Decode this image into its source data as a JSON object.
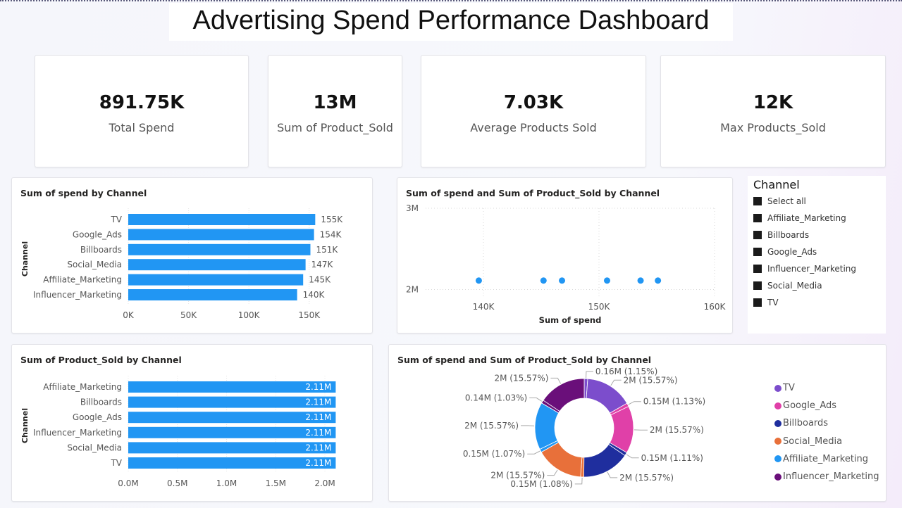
{
  "title": "Advertising Spend Performance Dashboard",
  "kpis": [
    {
      "value": "891.75K",
      "label": "Total Spend"
    },
    {
      "value": "13M",
      "label": "Sum of Product_Sold"
    },
    {
      "value": "7.03K",
      "label": "Average Products Sold"
    },
    {
      "value": "12K",
      "label": "Max Products_Sold"
    }
  ],
  "slicer": {
    "title": "Channel",
    "items": [
      "Select all",
      "Affiliate_Marketing",
      "Billboards",
      "Google_Ads",
      "Influencer_Marketing",
      "Social_Media",
      "TV"
    ]
  },
  "colors": {
    "bar": "#2196f3",
    "TV": "#7c4dcc",
    "Google_Ads": "#e040a8",
    "Billboards": "#1f2e9e",
    "Social_Media": "#e8703a",
    "Affiliate_Marketing": "#2196f3",
    "Influencer_Marketing": "#6a0f7a"
  },
  "chart_data": [
    {
      "type": "bar",
      "orientation": "horizontal",
      "title": "Sum of spend by Channel",
      "ylabel": "Channel",
      "categories": [
        "TV",
        "Google_Ads",
        "Billboards",
        "Social_Media",
        "Affiliate_Marketing",
        "Influencer_Marketing"
      ],
      "values": [
        155000,
        154000,
        151000,
        147000,
        145000,
        140000
      ],
      "data_labels": [
        "155K",
        "154K",
        "151K",
        "147K",
        "145K",
        "140K"
      ],
      "xlim": [
        0,
        170000
      ],
      "xticks": [
        0,
        50000,
        100000,
        150000
      ],
      "xtick_labels": [
        "0K",
        "50K",
        "100K",
        "150K"
      ]
    },
    {
      "type": "scatter",
      "title": "Sum of spend and Sum of Product_Sold by Channel",
      "xlabel": "Sum of spend",
      "x": [
        139600,
        145200,
        146800,
        150700,
        153600,
        155100
      ],
      "y": [
        2110000,
        2110000,
        2110000,
        2110000,
        2110000,
        2110000
      ],
      "xlim": [
        140000,
        160000
      ],
      "ylim": [
        1900000,
        3000000
      ],
      "xticks": [
        140000,
        150000,
        160000
      ],
      "xtick_labels": [
        "140K",
        "150K",
        "160K"
      ],
      "yticks": [
        2000000,
        3000000
      ],
      "ytick_labels": [
        "2M",
        "3M"
      ]
    },
    {
      "type": "bar",
      "orientation": "horizontal",
      "title": "Sum of Product_Sold by Channel",
      "ylabel": "Channel",
      "categories": [
        "Affiliate_Marketing",
        "Billboards",
        "Google_Ads",
        "Influencer_Marketing",
        "Social_Media",
        "TV"
      ],
      "values": [
        2110000,
        2110000,
        2110000,
        2110000,
        2110000,
        2110000
      ],
      "data_labels": [
        "2.11M",
        "2.11M",
        "2.11M",
        "2.11M",
        "2.11M",
        "2.11M"
      ],
      "xlim": [
        0,
        2100000
      ],
      "xticks": [
        0,
        500000,
        1000000,
        1500000,
        2000000
      ],
      "xtick_labels": [
        "0.0M",
        "0.5M",
        "1.0M",
        "1.5M",
        "2.0M"
      ]
    },
    {
      "type": "pie",
      "title": "Sum of spend and Sum of Product_Sold by Channel",
      "legend": [
        "TV",
        "Google_Ads",
        "Billboards",
        "Social_Media",
        "Affiliate_Marketing",
        "Influencer_Marketing"
      ],
      "slices": [
        {
          "channel": "TV",
          "measure": "spend",
          "value": 0.16,
          "pct": 1.15,
          "label": "0.16M (1.15%)"
        },
        {
          "channel": "TV",
          "measure": "product_sold",
          "value": 2,
          "pct": 15.57,
          "label": "2M (15.57%)"
        },
        {
          "channel": "Google_Ads",
          "measure": "spend",
          "value": 0.15,
          "pct": 1.13,
          "label": "0.15M (1.13%)"
        },
        {
          "channel": "Google_Ads",
          "measure": "product_sold",
          "value": 2,
          "pct": 15.57,
          "label": "2M (15.57%)"
        },
        {
          "channel": "Billboards",
          "measure": "spend",
          "value": 0.15,
          "pct": 1.11,
          "label": "0.15M (1.11%)"
        },
        {
          "channel": "Billboards",
          "measure": "product_sold",
          "value": 2,
          "pct": 15.57,
          "label": "2M (15.57%)"
        },
        {
          "channel": "Social_Media",
          "measure": "spend",
          "value": 0.15,
          "pct": 1.08,
          "label": "0.15M (1.08%)"
        },
        {
          "channel": "Social_Media",
          "measure": "product_sold",
          "value": 2,
          "pct": 15.57,
          "label": "2M (15.57%)"
        },
        {
          "channel": "Affiliate_Marketing",
          "measure": "spend",
          "value": 0.15,
          "pct": 1.07,
          "label": "0.15M (1.07%)"
        },
        {
          "channel": "Affiliate_Marketing",
          "measure": "product_sold",
          "value": 2,
          "pct": 15.57,
          "label": "2M (15.57%)"
        },
        {
          "channel": "Influencer_Marketing",
          "measure": "spend",
          "value": 0.14,
          "pct": 1.03,
          "label": "0.14M (1.03%)"
        },
        {
          "channel": "Influencer_Marketing",
          "measure": "product_sold",
          "value": 2,
          "pct": 15.57,
          "label": "2M (15.57%)"
        }
      ]
    }
  ]
}
